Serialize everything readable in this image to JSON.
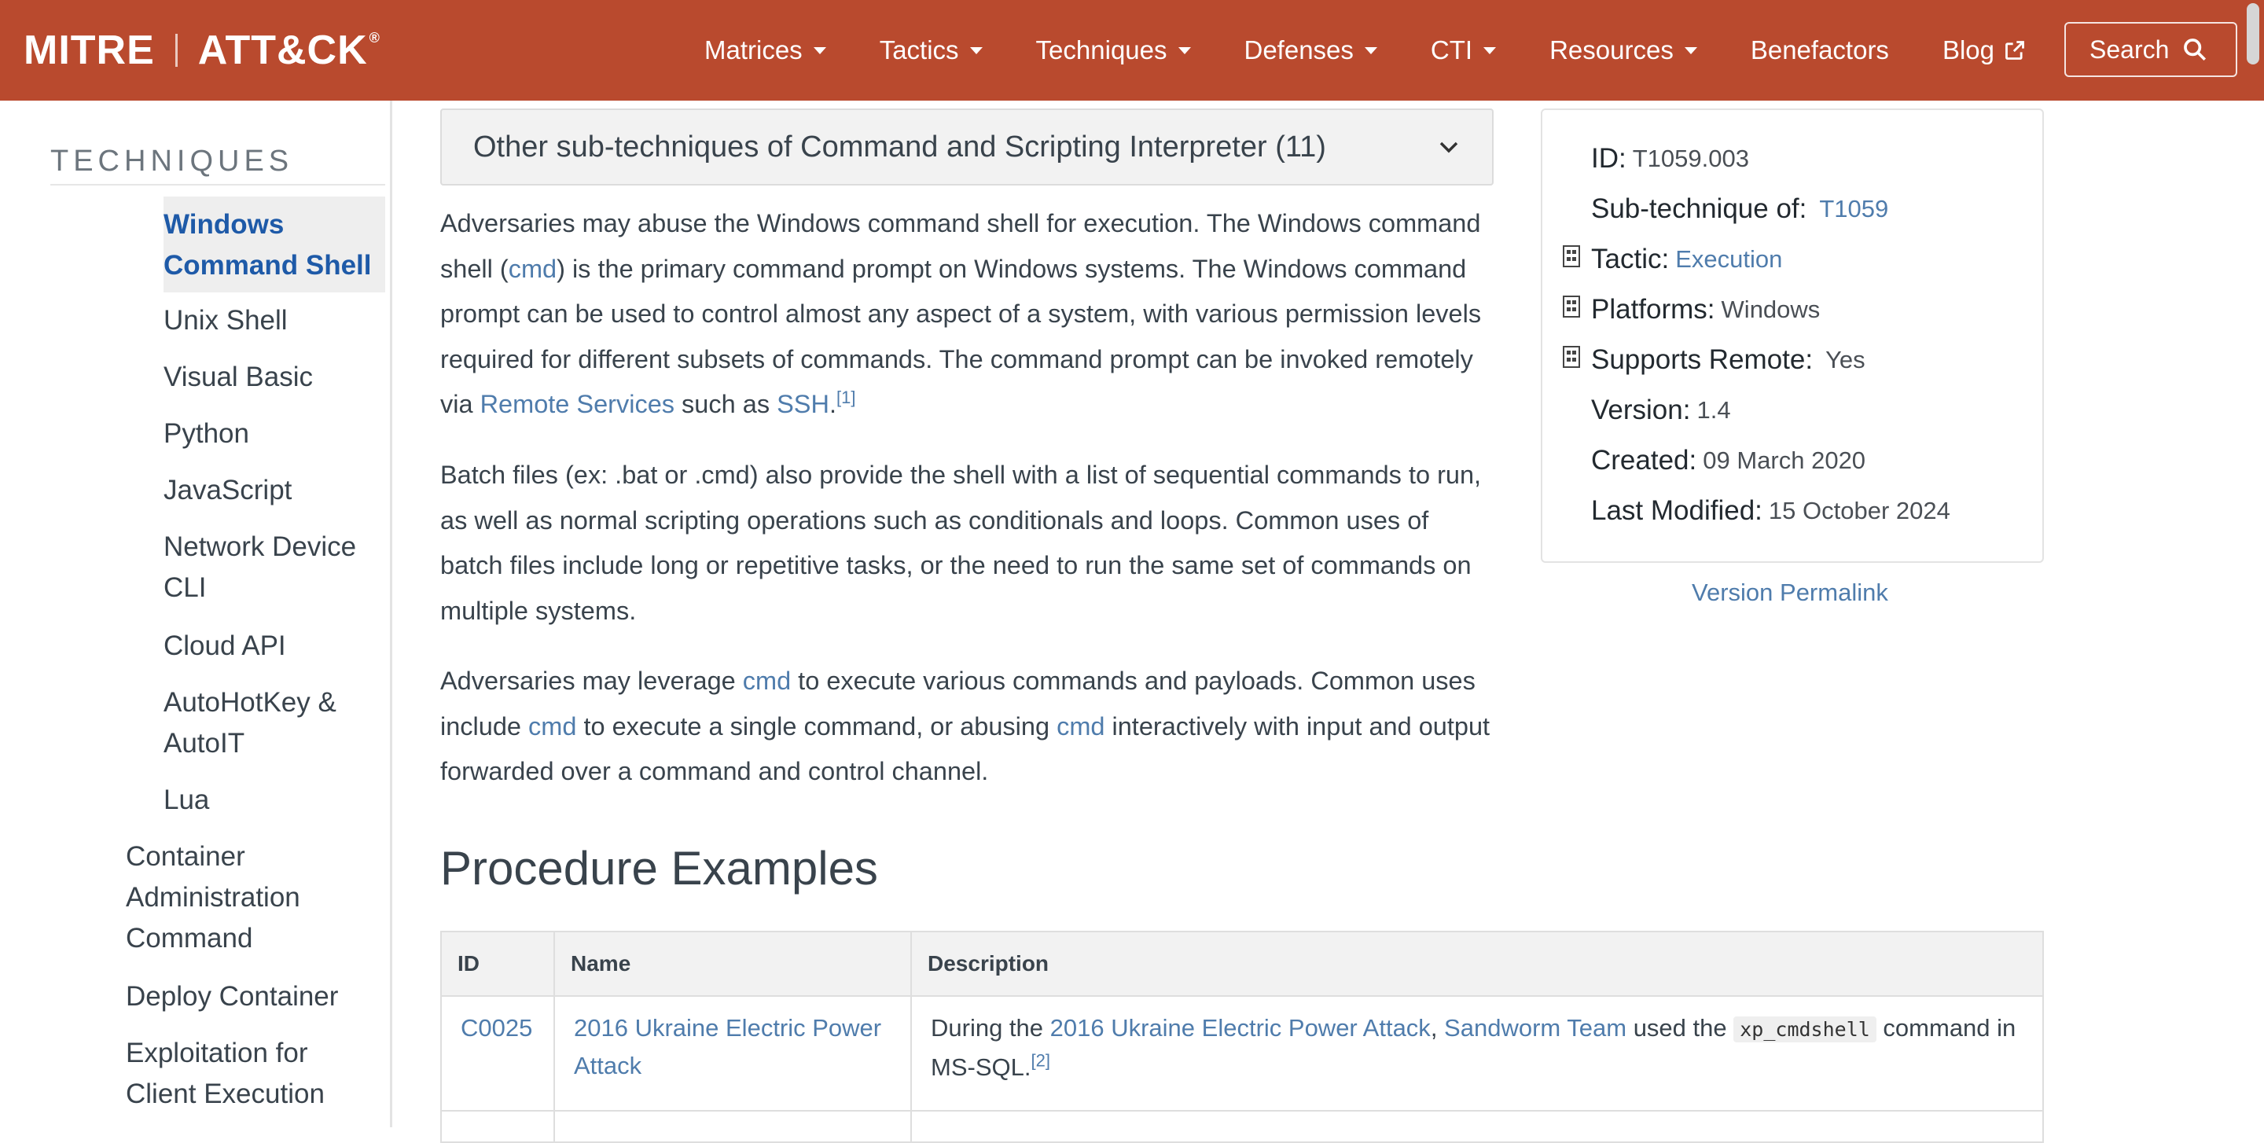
{
  "nav": {
    "logo_left": "MITRE",
    "logo_right": "ATT&CK",
    "logo_reg": "®",
    "items": [
      {
        "label": "Matrices"
      },
      {
        "label": "Tactics"
      },
      {
        "label": "Techniques"
      },
      {
        "label": "Defenses"
      },
      {
        "label": "CTI"
      },
      {
        "label": "Resources"
      },
      {
        "label": "Benefactors"
      },
      {
        "label": "Blog"
      }
    ],
    "search_label": "Search"
  },
  "sidebar": {
    "heading": "TECHNIQUES",
    "items": [
      {
        "label": "Windows Command Shell"
      },
      {
        "label": "Unix Shell"
      },
      {
        "label": "Visual Basic"
      },
      {
        "label": "Python"
      },
      {
        "label": "JavaScript"
      },
      {
        "label": "Network Device CLI"
      },
      {
        "label": "Cloud API"
      },
      {
        "label": "AutoHotKey & AutoIT"
      },
      {
        "label": "Lua"
      },
      {
        "label": "Container Administration Command"
      },
      {
        "label": "Deploy Container"
      },
      {
        "label": "Exploitation for Client Execution"
      }
    ]
  },
  "main": {
    "subtech_card": "Other sub-techniques of Command and Scripting Interpreter (11)",
    "p1": {
      "a": "Adversaries may abuse the Windows command shell for execution. The Windows command shell (",
      "cmd": "cmd",
      "b": ") is the primary command prompt on Windows systems. The Windows command prompt can be used to control almost any aspect of a system, with various permission levels required for different subsets of commands. The command prompt can be invoked remotely via ",
      "remote": "Remote Services",
      "c": " such as ",
      "ssh": "SSH",
      "d": ".",
      "ref": "[1]"
    },
    "p2": "Batch files (ex: .bat or .cmd) also provide the shell with a list of sequential commands to run, as well as normal scripting operations such as conditionals and loops. Common uses of batch files include long or repetitive tasks, or the need to run the same set of commands on multiple systems.",
    "p3": {
      "a": "Adversaries may leverage ",
      "cmd1": "cmd",
      "b": " to execute various commands and payloads. Common uses include ",
      "cmd2": "cmd",
      "c": " to execute a single command, or abusing ",
      "cmd3": "cmd",
      "d": " interactively with input and output forwarded over a command and control channel."
    },
    "procedure_title": "Procedure Examples"
  },
  "info": {
    "id_label": "ID:",
    "id_value": "T1059.003",
    "subtech_label": "Sub-technique of:",
    "subtech_value": "T1059",
    "tactic_label": "Tactic:",
    "tactic_value": "Execution",
    "platforms_label": "Platforms:",
    "platforms_value": "Windows",
    "remote_label": "Supports Remote:",
    "remote_value": "Yes",
    "version_label": "Version:",
    "version_value": "1.4",
    "created_label": "Created:",
    "created_value": "09 March 2020",
    "modified_label": "Last Modified:",
    "modified_value": "15 October 2024",
    "permalink": "Version Permalink"
  },
  "table": {
    "headers": [
      "ID",
      "Name",
      "Description"
    ],
    "rows": [
      {
        "id": "C0025",
        "name": "2016 Ukraine Electric Power Attack",
        "desc_a": "During the ",
        "desc_link1": "2016 Ukraine Electric Power Attack",
        "desc_b": ", ",
        "desc_link2": "Sandworm Team",
        "desc_c": " used the ",
        "desc_code": "xp_cmdshell",
        "desc_d": " command in MS-SQL.",
        "desc_ref": "[2]"
      }
    ]
  }
}
